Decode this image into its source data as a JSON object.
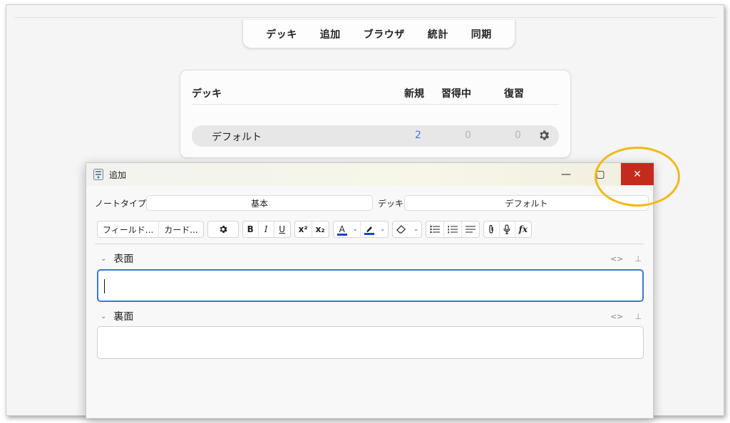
{
  "menubar": {
    "items": [
      "デッキ",
      "追加",
      "ブラウザ",
      "統計",
      "同期"
    ]
  },
  "deck_list": {
    "headers": {
      "deck": "デッキ",
      "new": "新規",
      "learning": "習得中",
      "review": "復習"
    },
    "rows": [
      {
        "name": "デフォルト",
        "new": "2",
        "learning": "0",
        "review": "0",
        "options_icon": "gear-icon"
      }
    ]
  },
  "add_window": {
    "title": "追加",
    "controls": {
      "minimize": "—",
      "maximize": "▢",
      "close": "✕"
    },
    "notetype_label": "ノートタイプ",
    "notetype_value": "基本",
    "deck_label": "デッキ",
    "deck_value": "デフォルト",
    "toolbar": {
      "fields_button": "フィールド...",
      "cards_button": "カード...",
      "options_icon": "gear-icon",
      "bold": "B",
      "italic": "I",
      "underline": "U",
      "superscript": "x²",
      "subscript": "x₂",
      "text_color": "A",
      "highlight_icon": "highlighter-icon",
      "eraser_icon": "eraser-icon",
      "unordered_list_icon": "bullet-list-icon",
      "ordered_list_icon": "numbered-list-icon",
      "align_icon": "align-icon",
      "attach_icon": "paperclip-icon",
      "record_icon": "microphone-icon",
      "math": "fx"
    },
    "fields": [
      {
        "name": "表面",
        "html_toggle": "<>",
        "pin_icon": "pin-icon"
      },
      {
        "name": "裏面",
        "html_toggle": "<>",
        "pin_icon": "pin-icon"
      }
    ]
  },
  "colors": {
    "accent_blue": "#3a78d4",
    "close_red": "#c42b1c",
    "annotation_yellow": "#f3b814",
    "text_color_underline": "#1a3ed6"
  }
}
